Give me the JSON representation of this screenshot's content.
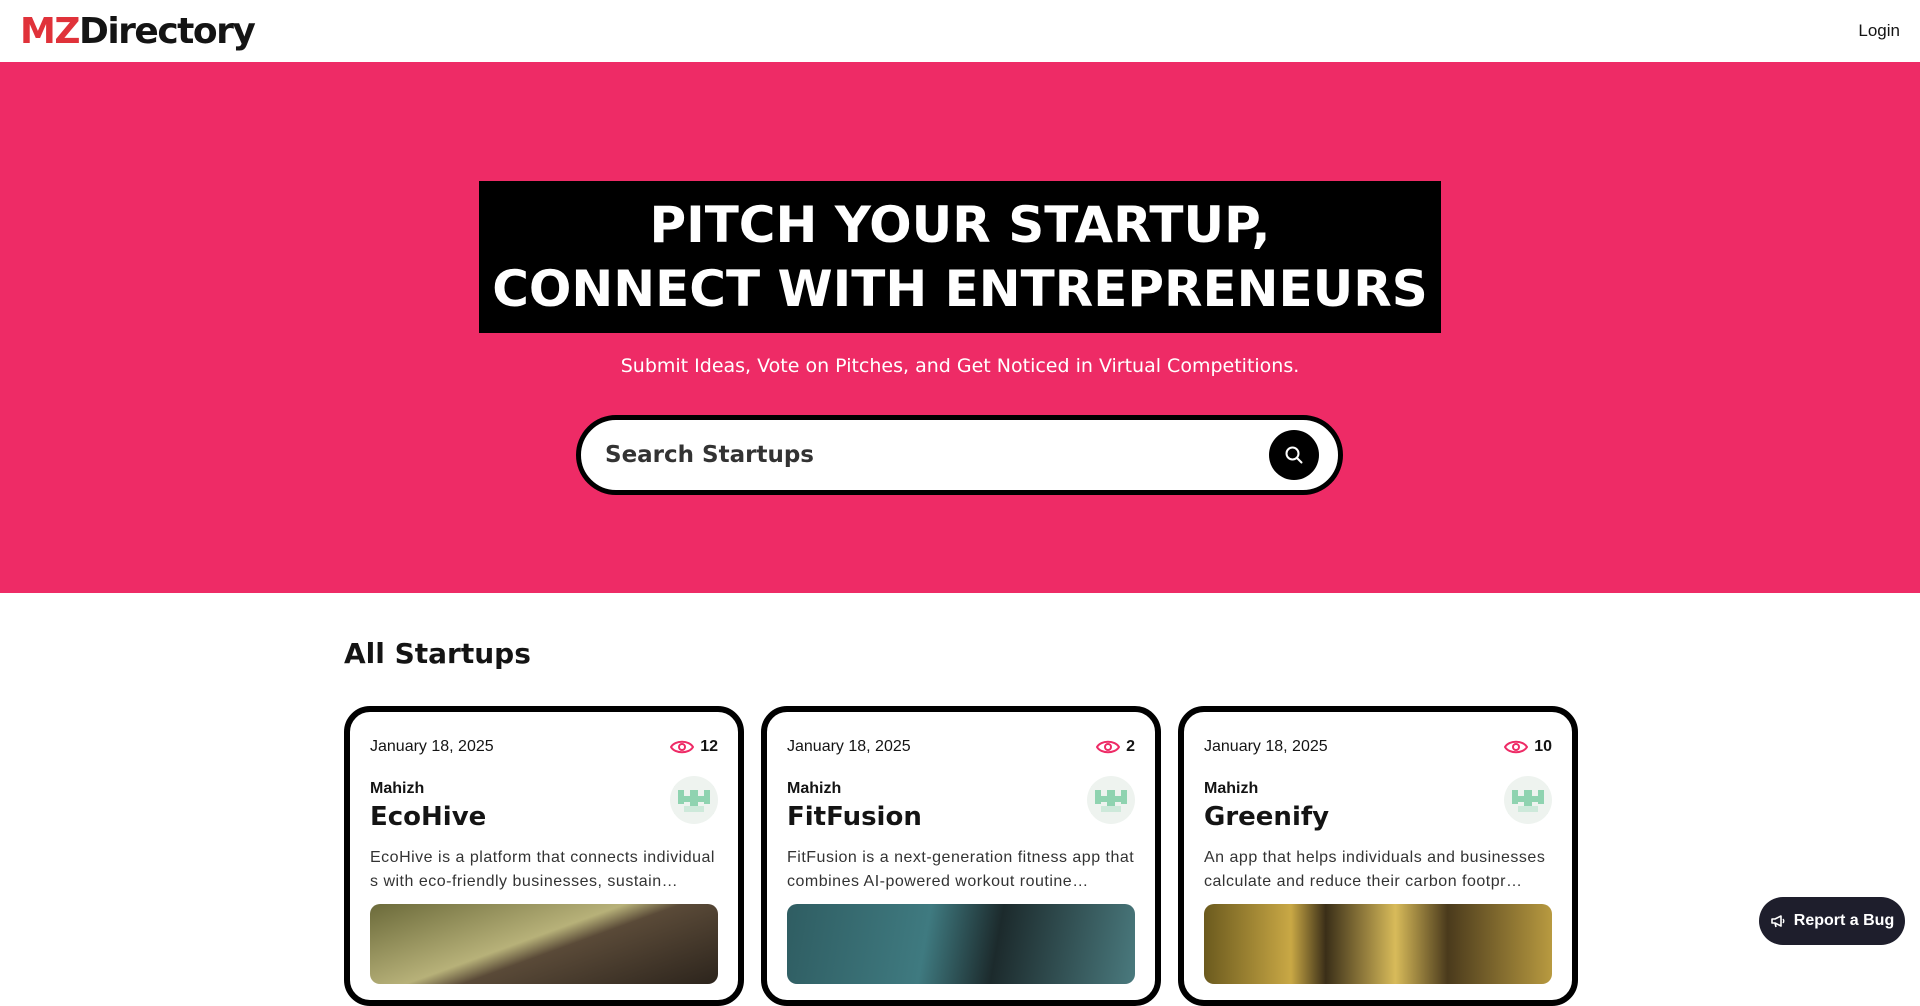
{
  "nav": {
    "logo_part1": "MZ",
    "logo_part2": "Directory",
    "login_label": "Login"
  },
  "hero": {
    "headline_line1": "PITCH YOUR STARTUP,",
    "headline_line2": "CONNECT WITH ENTREPRENEURS",
    "subtitle": "Submit Ideas, Vote on Pitches, and Get Noticed in Virtual Competitions.",
    "search_placeholder": "Search Startups"
  },
  "section": {
    "title": "All Startups"
  },
  "startups": [
    {
      "date": "January 18, 2025",
      "views": "12",
      "author": "Mahizh",
      "name": "EcoHive",
      "description": "EcoHive is a platform that connects individuals with eco-friendly businesses, sustain…",
      "image": "soil-in-hands"
    },
    {
      "date": "January 18, 2025",
      "views": "2",
      "author": "Mahizh",
      "name": "FitFusion",
      "description": "FitFusion is a next-generation fitness app that combines AI-powered workout routine…",
      "image": "barbell-workout"
    },
    {
      "date": "January 18, 2025",
      "views": "10",
      "author": "Mahizh",
      "name": "Greenify",
      "description": "An app that helps individuals and businesses calculate and reduce their carbon footpr…",
      "image": "autumn-forest"
    }
  ],
  "bug_button": {
    "label": "Report a Bug"
  },
  "colors": {
    "hero_bg": "#ee2b66",
    "logo_red": "#e0323a",
    "eye_icon": "#ee2b66",
    "bug_bg": "#1e1e2c"
  }
}
